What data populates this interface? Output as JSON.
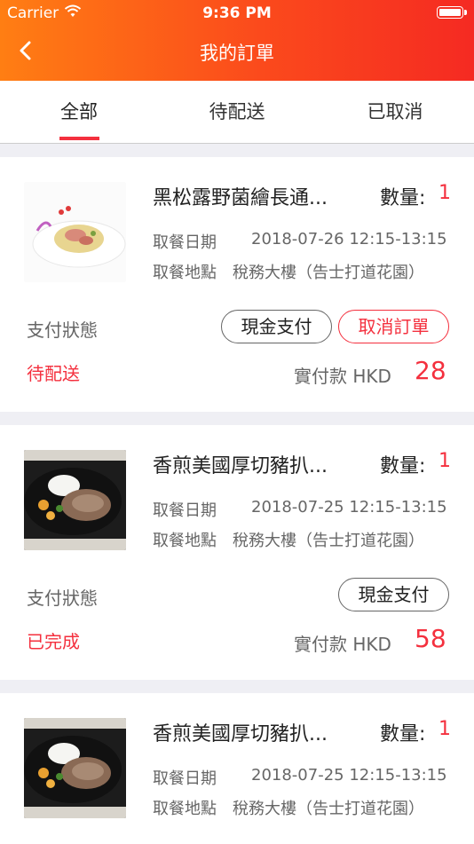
{
  "status_bar": {
    "carrier": "Carrier",
    "time": "9:36 PM"
  },
  "nav": {
    "title": "我的訂單"
  },
  "tabs": [
    {
      "label": "全部",
      "active": true
    },
    {
      "label": "待配送",
      "active": false
    },
    {
      "label": "已取消",
      "active": false
    }
  ],
  "orders": [
    {
      "name": "黑松露野菌繪長通...",
      "qty_label": "數量:",
      "qty": "1",
      "date_label": "取餐日期",
      "date": "2018-07-26 12:15-13:15",
      "place_label": "取餐地點",
      "place": "稅務大樓（告士打道花園）",
      "pay_label": "支付狀態",
      "status": "待配送",
      "cash_label": "現金支付",
      "cancel_label": "取消訂單",
      "paid_label": "實付款 HKD",
      "paid": "28"
    },
    {
      "name": "香煎美國厚切豬扒...",
      "qty_label": "數量:",
      "qty": "1",
      "date_label": "取餐日期",
      "date": "2018-07-25 12:15-13:15",
      "place_label": "取餐地點",
      "place": "稅務大樓（告士打道花園）",
      "pay_label": "支付狀態",
      "status": "已完成",
      "cash_label": "現金支付",
      "paid_label": "實付款 HKD",
      "paid": "58"
    },
    {
      "name": "香煎美國厚切豬扒...",
      "qty_label": "數量:",
      "qty": "1",
      "date_label": "取餐日期",
      "date": "2018-07-25 12:15-13:15",
      "place_label": "取餐地點",
      "place": "稅務大樓（告士打道花園）"
    }
  ],
  "colors": {
    "accent": "#f4303e",
    "header_start": "#ff7e13",
    "header_end": "#f52a22"
  }
}
